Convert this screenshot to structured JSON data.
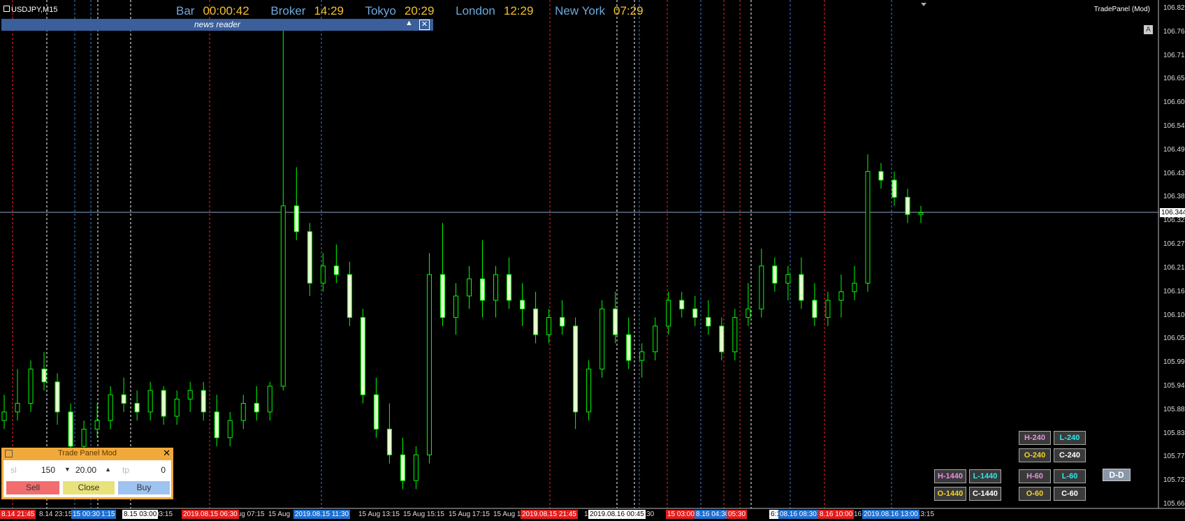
{
  "chart": {
    "symbol": "USDJPY,M15",
    "panel_label": "TradePanel (Mod)",
    "auto_scroll_label": "A",
    "current_price": "106.344"
  },
  "sessions": {
    "bar_label": "Bar",
    "bar_time": "00:00:42",
    "broker_label": "Broker",
    "broker_time": "14:29",
    "tokyo_label": "Tokyo",
    "tokyo_time": "20:29",
    "london_label": "London",
    "london_time": "12:29",
    "newyork_label": "New York",
    "newyork_time": "07:29"
  },
  "news_reader": {
    "title": "news reader",
    "collapse_symbol": "▲",
    "close_symbol": "✕"
  },
  "price_axis": [
    "106.820",
    "106.765",
    "106.710",
    "106.655",
    "106.600",
    "106.545",
    "106.490",
    "106.435",
    "106.380",
    "106.325",
    "106.270",
    "106.215",
    "106.160",
    "106.105",
    "106.050",
    "105.995",
    "105.940",
    "105.885",
    "105.830",
    "105.775",
    "105.720",
    "105.665"
  ],
  "time_axis": {
    "plain": [
      {
        "t": "8.14 23:15"
      },
      {
        "t": "03:15"
      },
      {
        "t": "Aug 07:15"
      },
      {
        "t": "15 Aug"
      },
      {
        "t": ".5"
      },
      {
        "t": "15 Aug 13:15"
      },
      {
        "t": "15 Aug 15:15"
      },
      {
        "t": "15 Aug 17:15"
      },
      {
        "t": "15 Aug 19"
      },
      {
        "t": "1:"
      },
      {
        "t": "):30"
      },
      {
        "t": "45"
      },
      {
        "t": "16 A"
      },
      {
        "t": "13:15"
      }
    ],
    "boxes": [
      {
        "t": "8.14 21:45",
        "color": "red"
      },
      {
        "t": "15 00:30",
        "color": "blue"
      },
      {
        "t": "1:15",
        "color": "blue"
      },
      {
        "t": "8.15 03:00",
        "color": "white"
      },
      {
        "t": "2019.08.15 06:30",
        "color": "red"
      },
      {
        "t": "2019.08.15 11:30",
        "color": "blue"
      },
      {
        "t": "2019.08.15 21:45",
        "color": "red"
      },
      {
        "t": "2019.08.16 00:45",
        "color": "white"
      },
      {
        "t": "15 03:00",
        "color": "red"
      },
      {
        "t": "8.16 04:30",
        "color": "blue"
      },
      {
        "t": "05:30",
        "color": "red"
      },
      {
        "t": "6:15",
        "color": "white"
      },
      {
        "t": "08.16 08:30",
        "color": "blue"
      },
      {
        "t": "8.16 10:00",
        "color": "red"
      },
      {
        "t": "2019.08.16 13:00",
        "color": "blue"
      }
    ]
  },
  "levels": {
    "h240": "H-240",
    "l240": "L-240",
    "o240": "O-240",
    "c240": "C-240",
    "h1440": "H-1440",
    "l1440": "L-1440",
    "o1440": "O-1440",
    "c1440": "C-1440",
    "h60": "H-60",
    "l60": "L-60",
    "o60": "O-60",
    "c60": "C-60",
    "dd": "D-D"
  },
  "trade_panel": {
    "title": "Trade Panel Mod",
    "close_symbol": "✕",
    "sl_placeholder": "sl",
    "sl_value": "150",
    "lots_value": "20.00",
    "tp_placeholder": "tp",
    "tp_value": "0",
    "sell_label": "Sell",
    "close_label": "Close",
    "buy_label": "Buy"
  },
  "colors": {
    "bull": "#00ff00",
    "bear_fill": "#000000",
    "red_line": "#ff2020",
    "blue_line": "#3b82d6",
    "white_line": "#ffffff",
    "sell": "#f26d6d",
    "close": "#e8e27a",
    "buy": "#9ec3f0"
  },
  "chart_data": {
    "type": "candlestick",
    "ylim": [
      105.665,
      106.82
    ],
    "candles": [
      [
        105.86,
        105.92,
        105.84,
        105.88
      ],
      [
        105.88,
        105.98,
        105.86,
        105.9
      ],
      [
        105.9,
        106.0,
        105.88,
        105.98
      ],
      [
        105.98,
        106.02,
        105.93,
        105.95
      ],
      [
        105.95,
        105.97,
        105.85,
        105.88
      ],
      [
        105.88,
        105.9,
        105.78,
        105.8
      ],
      [
        105.8,
        105.86,
        105.76,
        105.84
      ],
      [
        105.84,
        105.9,
        105.82,
        105.86
      ],
      [
        105.86,
        105.94,
        105.84,
        105.92
      ],
      [
        105.92,
        105.96,
        105.88,
        105.9
      ],
      [
        105.9,
        105.93,
        105.86,
        105.88
      ],
      [
        105.88,
        105.95,
        105.86,
        105.93
      ],
      [
        105.93,
        105.94,
        105.85,
        105.87
      ],
      [
        105.87,
        105.93,
        105.85,
        105.91
      ],
      [
        105.91,
        105.95,
        105.88,
        105.93
      ],
      [
        105.93,
        105.95,
        105.86,
        105.88
      ],
      [
        105.88,
        105.92,
        105.8,
        105.82
      ],
      [
        105.82,
        105.88,
        105.8,
        105.86
      ],
      [
        105.86,
        105.92,
        105.84,
        105.9
      ],
      [
        105.9,
        105.94,
        105.86,
        105.88
      ],
      [
        105.88,
        105.95,
        105.86,
        105.94
      ],
      [
        105.94,
        106.78,
        105.93,
        106.36
      ],
      [
        106.36,
        106.45,
        106.28,
        106.3
      ],
      [
        106.3,
        106.32,
        106.15,
        106.18
      ],
      [
        106.18,
        106.25,
        106.16,
        106.22
      ],
      [
        106.22,
        106.27,
        106.18,
        106.2
      ],
      [
        106.2,
        106.23,
        106.08,
        106.1
      ],
      [
        106.1,
        106.12,
        105.9,
        105.92
      ],
      [
        105.92,
        105.96,
        105.82,
        105.84
      ],
      [
        105.84,
        105.9,
        105.76,
        105.78
      ],
      [
        105.78,
        105.82,
        105.7,
        105.72
      ],
      [
        105.72,
        105.8,
        105.7,
        105.78
      ],
      [
        105.78,
        106.25,
        105.76,
        106.2
      ],
      [
        106.2,
        106.32,
        106.08,
        106.1
      ],
      [
        106.1,
        106.18,
        106.06,
        106.15
      ],
      [
        106.15,
        106.22,
        106.12,
        106.19
      ],
      [
        106.19,
        106.28,
        106.1,
        106.14
      ],
      [
        106.14,
        106.22,
        106.1,
        106.2
      ],
      [
        106.2,
        106.24,
        106.12,
        106.14
      ],
      [
        106.14,
        106.18,
        106.08,
        106.12
      ],
      [
        106.12,
        106.16,
        106.04,
        106.06
      ],
      [
        106.06,
        106.12,
        106.04,
        106.1
      ],
      [
        106.1,
        106.14,
        106.06,
        106.08
      ],
      [
        106.08,
        106.1,
        105.84,
        105.88
      ],
      [
        105.88,
        106.0,
        105.86,
        105.98
      ],
      [
        105.98,
        106.14,
        105.96,
        106.12
      ],
      [
        106.12,
        106.16,
        106.04,
        106.06
      ],
      [
        106.06,
        106.1,
        105.98,
        106.0
      ],
      [
        106.0,
        106.04,
        105.96,
        106.02
      ],
      [
        106.02,
        106.1,
        106.0,
        106.08
      ],
      [
        106.08,
        106.16,
        106.06,
        106.14
      ],
      [
        106.14,
        106.16,
        106.1,
        106.12
      ],
      [
        106.12,
        106.15,
        106.08,
        106.1
      ],
      [
        106.1,
        106.14,
        106.06,
        106.08
      ],
      [
        106.08,
        106.1,
        106.0,
        106.02
      ],
      [
        106.02,
        106.12,
        106.0,
        106.1
      ],
      [
        106.1,
        106.18,
        106.08,
        106.12
      ],
      [
        106.12,
        106.26,
        106.1,
        106.22
      ],
      [
        106.22,
        106.24,
        106.16,
        106.18
      ],
      [
        106.18,
        106.22,
        106.14,
        106.2
      ],
      [
        106.2,
        106.24,
        106.12,
        106.14
      ],
      [
        106.14,
        106.18,
        106.08,
        106.1
      ],
      [
        106.1,
        106.16,
        106.08,
        106.14
      ],
      [
        106.14,
        106.2,
        106.1,
        106.16
      ],
      [
        106.16,
        106.22,
        106.14,
        106.18
      ],
      [
        106.18,
        106.48,
        106.16,
        106.44
      ],
      [
        106.44,
        106.46,
        106.4,
        106.42
      ],
      [
        106.42,
        106.44,
        106.36,
        106.38
      ],
      [
        106.38,
        106.4,
        106.32,
        106.34
      ],
      [
        106.34,
        106.36,
        106.32,
        106.344
      ]
    ]
  }
}
